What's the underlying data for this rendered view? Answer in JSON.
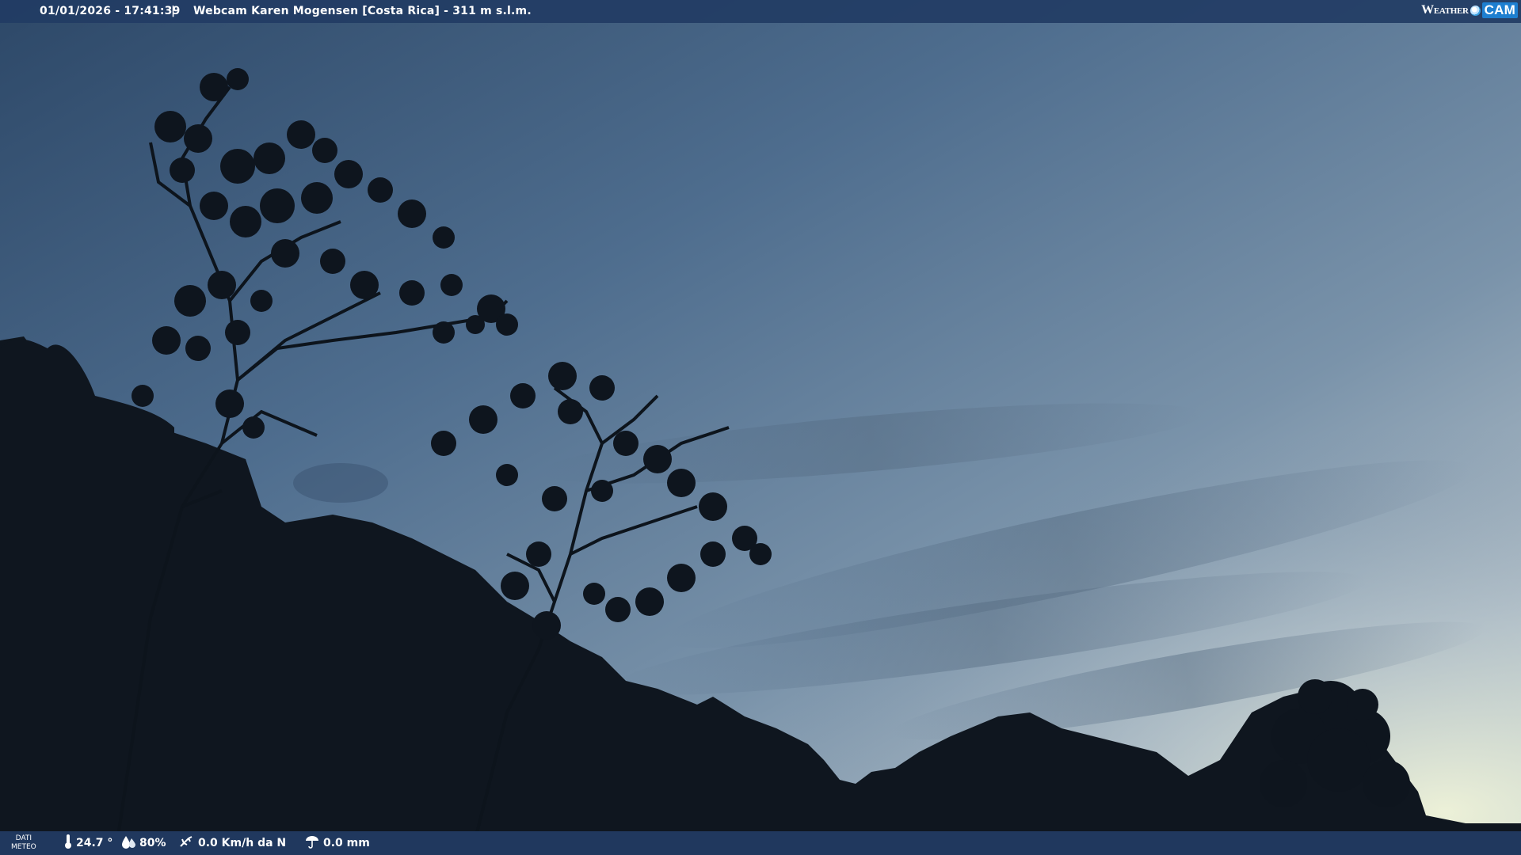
{
  "header": {
    "timestamp": "01/01/2026 - 17:41:39",
    "separator": "|",
    "title": "Webcam Karen Mogensen [Costa Rica] - 311 m s.l.m."
  },
  "logo": {
    "weather": "Weather",
    "cam": "CAM"
  },
  "footer": {
    "dati_line1": "DATI",
    "dati_line2": "METEO",
    "temperature": "24.7 °",
    "humidity": "80%",
    "wind": "0.0 Km/h da N",
    "rain": "0.0 mm"
  },
  "icons": {
    "temperature": "thermometer-icon",
    "humidity": "humidity-drop-icon",
    "wind": "wind-icon",
    "rain": "rain-icon"
  },
  "colors": {
    "bar": "#223c64",
    "sky_top": "#3f5f80",
    "sky_horizon": "#e6edd8",
    "silhouette": "#0e141c"
  }
}
